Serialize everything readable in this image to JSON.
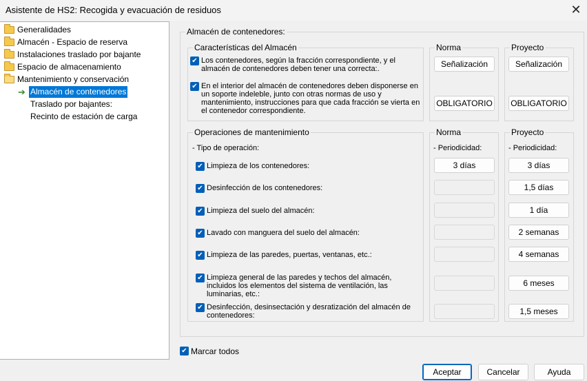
{
  "window": {
    "title": "Asistente de HS2: Recogida y evacuación de residuos",
    "close_icon": "close-icon"
  },
  "tree": {
    "items": [
      {
        "label": "Generalidades",
        "icon": "folder-icon"
      },
      {
        "label": "Almacén - Espacio de reserva",
        "icon": "folder-icon"
      },
      {
        "label": "Instalaciones traslado por bajante",
        "icon": "folder-icon"
      },
      {
        "label": "Espacio de almacenamiento",
        "icon": "folder-icon"
      },
      {
        "label": "Mantenimiento y conservación",
        "icon": "folder-open-icon"
      },
      {
        "label": "Almacén de contenedores",
        "icon": "arrow-right-icon",
        "selected": true
      },
      {
        "label": "Traslado por bajantes:"
      },
      {
        "label": "Recinto de estación de carga"
      }
    ]
  },
  "main": {
    "title": "Almacén de contenedores:",
    "caracteristicas": {
      "title": "Características del Almacén",
      "items": [
        "Los contenedores, según la fracción correspondiente, y el almacén de contenedores deben tener una correcta:.",
        "En el interior del almacén de contenedores deben disponerse en un soporte indeleble, junto con otras normas de uso y mantenimiento, instrucciones para que cada fracción se vierta en el contenedor correspondiente."
      ]
    },
    "norma1": {
      "title": "Norma",
      "buttons": [
        "Señalización",
        "OBLIGATORIO"
      ]
    },
    "proyecto1": {
      "title": "Proyecto",
      "buttons": [
        "Señalización",
        "OBLIGATORIO"
      ]
    },
    "operaciones": {
      "title": "Operaciones de mantenimiento",
      "tipo_label": "- Tipo de operación:",
      "items": [
        "Limpieza de los contenedores:",
        "Desinfección de los contenedores:",
        "Limpieza del suelo del almacén:",
        "Lavado con manguera del suelo del almacén:",
        "Limpieza de las paredes, puertas, ventanas, etc.:",
        "Limpieza general de las paredes y techos del almacén, incluidos los elementos del sistema de ventilación, las luminarias, etc.:",
        "Desinfección, desinsectación y desratización del almacén de contenedores:"
      ]
    },
    "norma2": {
      "title": "Norma",
      "periodicidad_label": "- Periodicidad:",
      "values": [
        "3 días",
        "",
        "",
        "",
        "",
        "",
        ""
      ]
    },
    "proyecto2": {
      "title": "Proyecto",
      "periodicidad_label": "- Periodicidad:",
      "values": [
        "3 días",
        "1,5 días",
        "1 día",
        "2 semanas",
        "4 semanas",
        "6 meses",
        "1,5 meses"
      ]
    }
  },
  "marcar_todos": "Marcar todos",
  "footer": {
    "accept": "Aceptar",
    "cancel": "Cancelar",
    "help": "Ayuda"
  },
  "colors": {
    "accent": "#005fb8",
    "selection": "#0078d7",
    "folder": "#f5c94b"
  }
}
